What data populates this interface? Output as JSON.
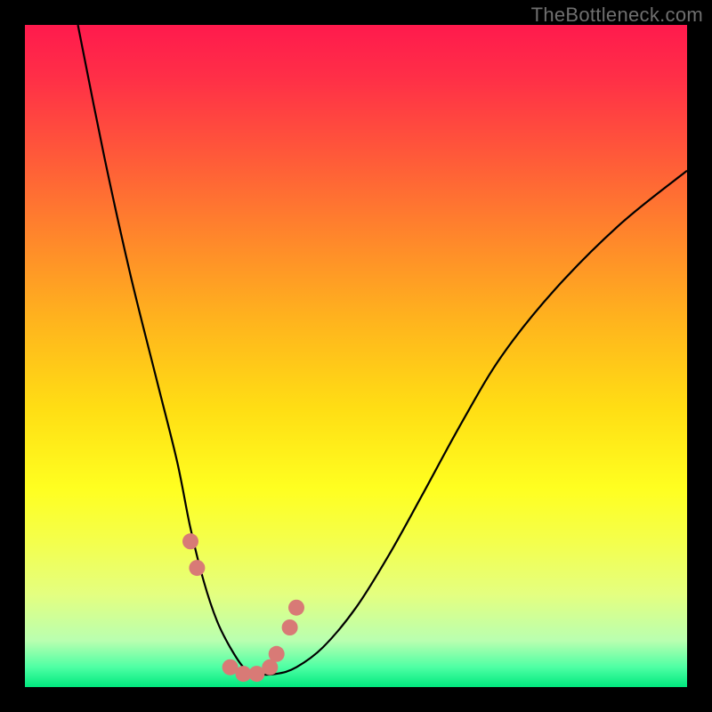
{
  "watermark": "TheBottleneck.com",
  "colors": {
    "background": "#000000",
    "gradient_top": "#ff1a4d",
    "gradient_bottom": "#00e87e",
    "curve": "#000000",
    "marker": "#d87a76"
  },
  "chart_data": {
    "type": "line",
    "title": "",
    "xlabel": "",
    "ylabel": "",
    "xlim": [
      0,
      100
    ],
    "ylim": [
      0,
      100
    ],
    "grid": false,
    "legend": false,
    "series": [
      {
        "name": "bottleneck-curve",
        "x": [
          8,
          12,
          16,
          20,
          23,
          25,
          27,
          29,
          31,
          33,
          35,
          38,
          41,
          45,
          50,
          55,
          60,
          66,
          72,
          80,
          90,
          100
        ],
        "y": [
          100,
          80,
          62,
          46,
          34,
          24,
          16,
          10,
          6,
          3,
          2,
          2,
          3,
          6,
          12,
          20,
          29,
          40,
          50,
          60,
          70,
          78
        ]
      }
    ],
    "markers": {
      "name": "highlight-points",
      "x": [
        25,
        26,
        31,
        33,
        35,
        37,
        38,
        40,
        41
      ],
      "y": [
        22,
        18,
        3,
        2,
        2,
        3,
        5,
        9,
        12
      ]
    }
  }
}
